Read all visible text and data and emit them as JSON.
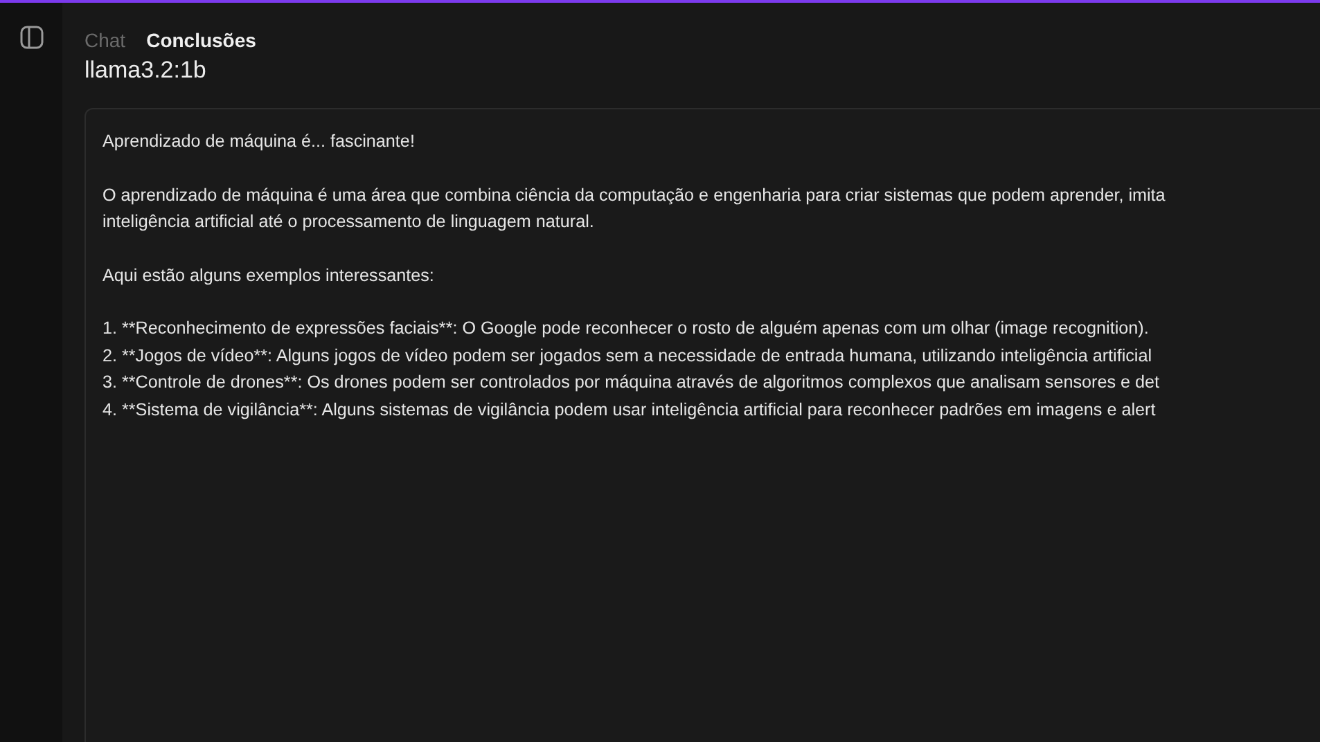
{
  "tabs": [
    {
      "label": "Chat",
      "selected": false
    },
    {
      "label": "Conclusões",
      "selected": true
    }
  ],
  "model": "llama3.2:1b",
  "output": {
    "paragraphs": [
      [
        "Aprendizado de máquina é... fascinante!"
      ],
      [
        "O aprendizado de máquina é uma área que combina ciência da computação e engenharia para criar sistemas que podem aprender, imita",
        "inteligência artificial até o processamento de linguagem natural."
      ],
      [
        "Aqui estão alguns exemplos interessantes:"
      ],
      [
        "1. **Reconhecimento de expressões faciais**: O Google pode reconhecer o rosto de alguém apenas com um olhar (image recognition).",
        "2. **Jogos de vídeo**: Alguns jogos de vídeo podem ser jogados sem a necessidade de entrada humana, utilizando inteligência artificial",
        "3. **Controle de drones**: Os drones podem ser controlados por máquina através de algoritmos complexos que analisam sensores e det",
        "4. **Sistema de vigilância**: Alguns sistemas de vigilância podem usar inteligência artificial para reconhecer padrões em imagens e alert"
      ]
    ]
  }
}
